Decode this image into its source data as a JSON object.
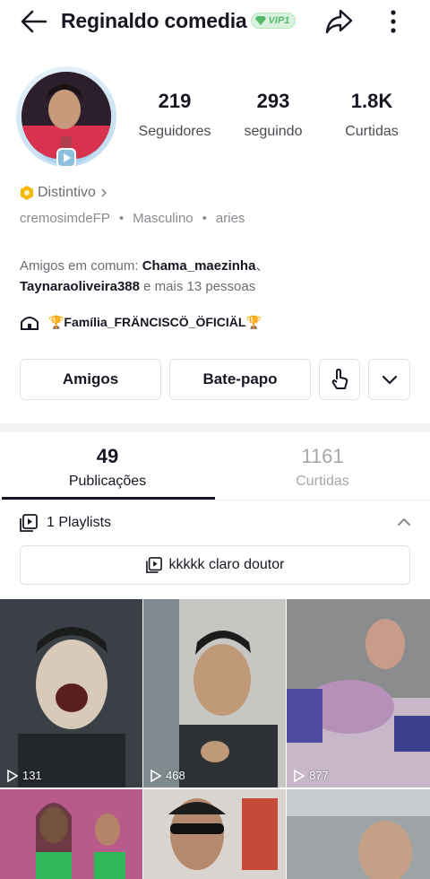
{
  "header": {
    "title": "Reginaldo comedia",
    "vip_label": "VIP1"
  },
  "stats": [
    {
      "value": "219",
      "label": "Seguidores"
    },
    {
      "value": "293",
      "label": "seguindo"
    },
    {
      "value": "1.8K",
      "label": "Curtidas"
    }
  ],
  "profile": {
    "badge_label": "Distintivo",
    "username": "cremosimdeFP",
    "gender": "Masculino",
    "sign": "aries"
  },
  "mutual": {
    "prefix": "Amigos em comum: ",
    "friend1": "Chama_maezinha",
    "sep": "、",
    "friend2": "Taynaraoliveira388",
    "suffix": " e mais 13 pessoas"
  },
  "family": {
    "name": "🏆Família_FRÄNCISCÖ_ÖFICIÄL🏆"
  },
  "actions": {
    "friends": "Amigos",
    "chat": "Bate-papo"
  },
  "tabs": [
    {
      "count": "49",
      "label": "Publicações"
    },
    {
      "count": "1161",
      "label": "Curtidas"
    }
  ],
  "playlists": {
    "header": "1 Playlists",
    "item": "kkkkk claro doutor"
  },
  "videos": [
    {
      "views": "131"
    },
    {
      "views": "468"
    },
    {
      "views": "877"
    }
  ],
  "colors": {
    "primary_text": "#161823",
    "secondary_text": "#6b6d74",
    "vip_green": "#56b86a",
    "badge_gold": "#f2b705"
  }
}
